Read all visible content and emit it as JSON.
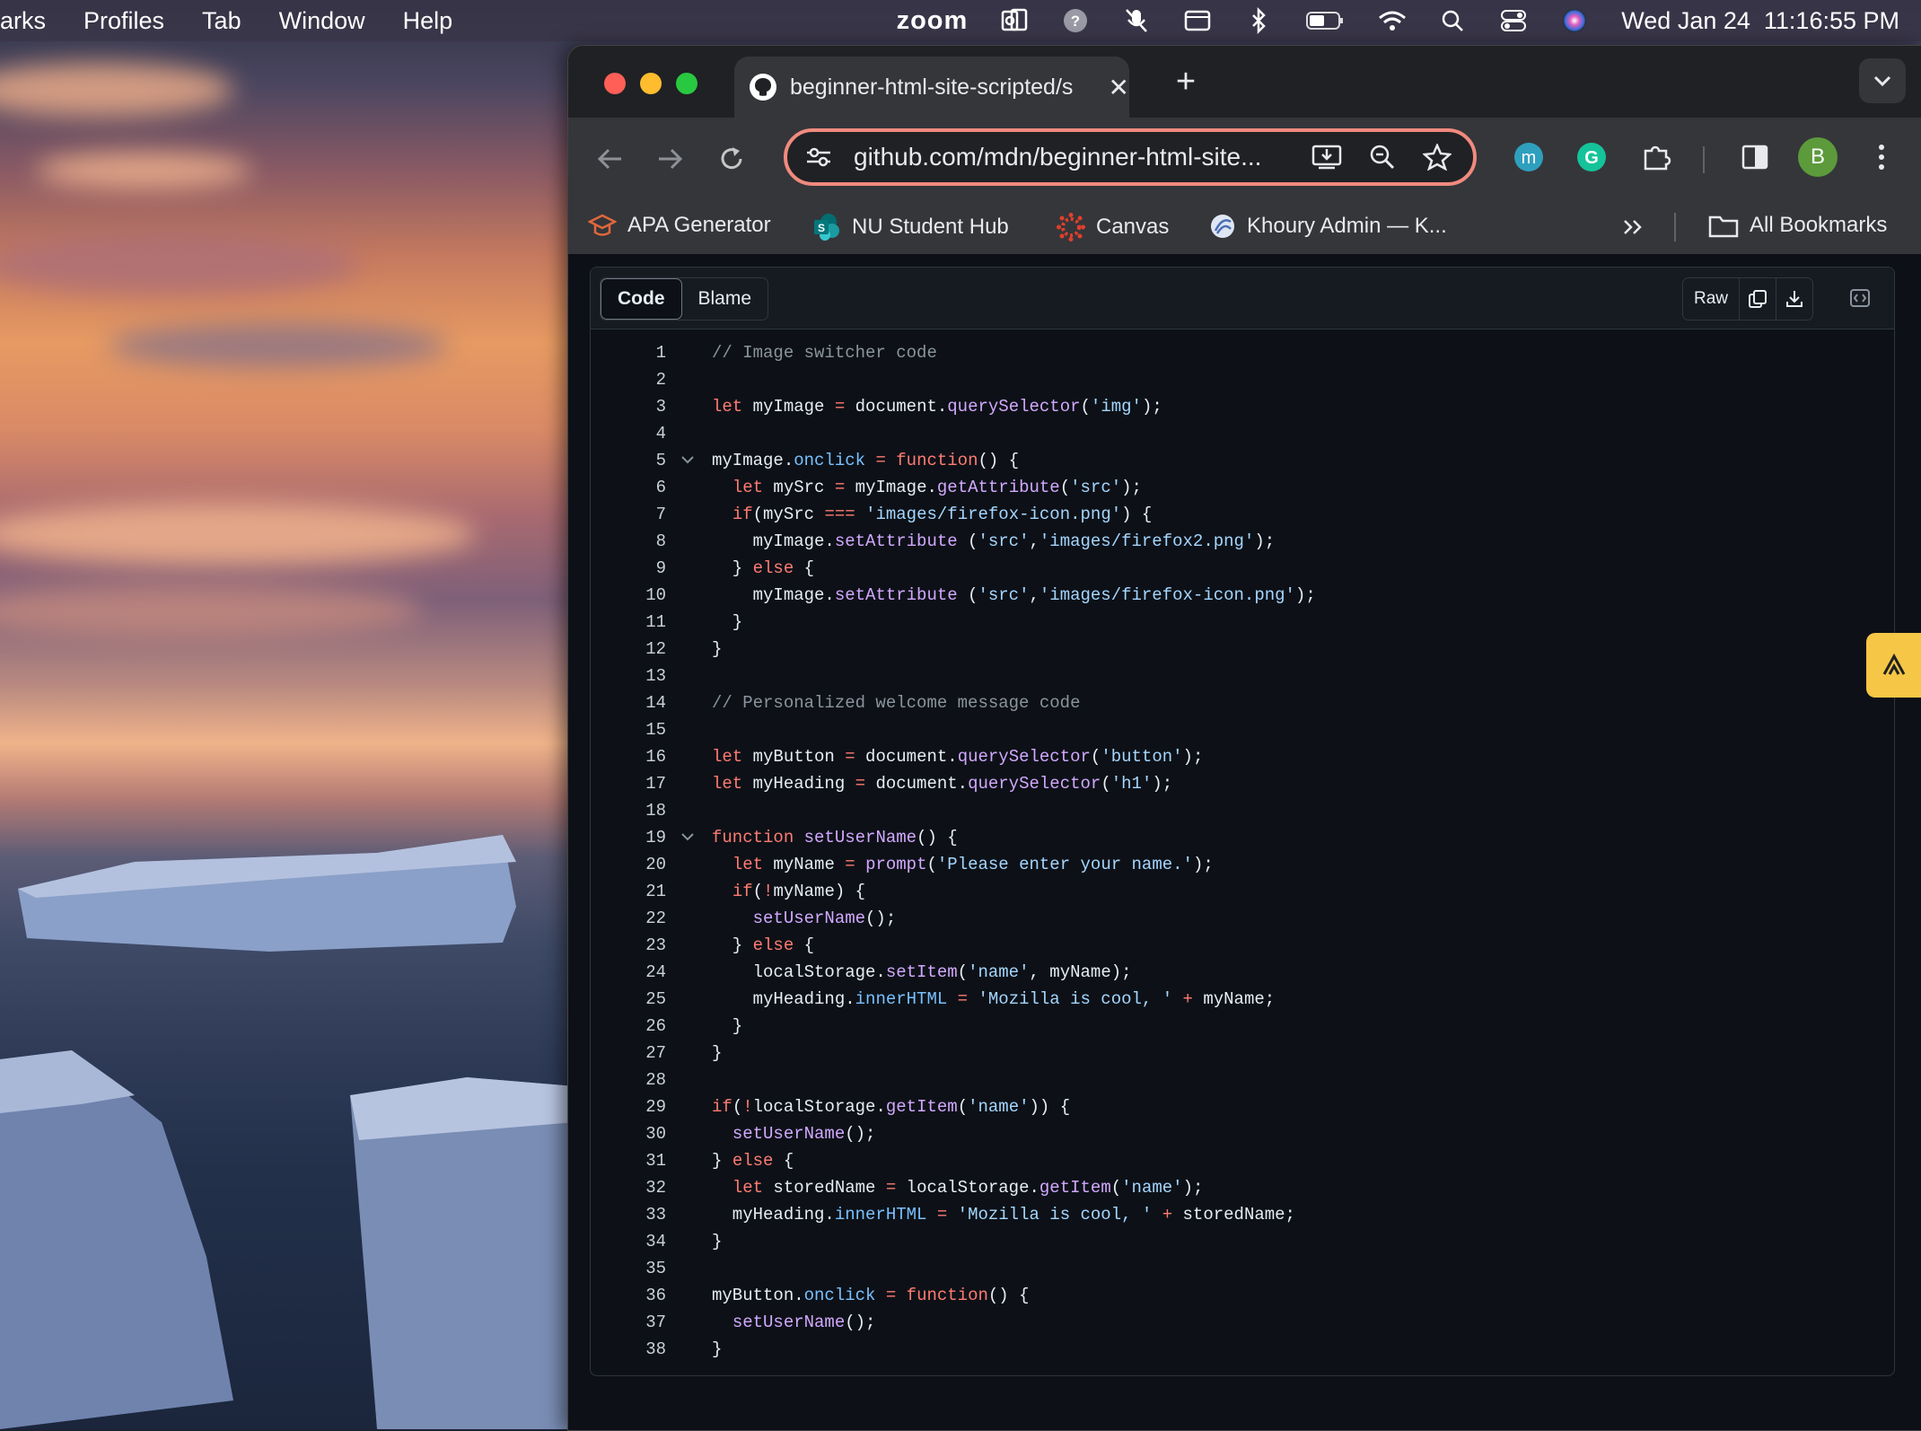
{
  "menubar": {
    "app_menu_partial": "arks",
    "items": [
      "Profiles",
      "Tab",
      "Window",
      "Help"
    ],
    "zoom_label": "zoom",
    "datetime": "Wed Jan 24  11:16:55 PM"
  },
  "browser": {
    "tab_title": "beginner-html-site-scripted/s",
    "url": "github.com/mdn/beginner-html-site...",
    "profile_initial": "B",
    "bookmarks": [
      {
        "label": "APA Generator",
        "icon": "apa-icon"
      },
      {
        "label": "NU Student Hub",
        "icon": "sharepoint-icon"
      },
      {
        "label": "Canvas",
        "icon": "canvas-icon"
      },
      {
        "label": "Khoury Admin — K...",
        "icon": "khoury-icon"
      }
    ],
    "all_bookmarks": "All Bookmarks"
  },
  "viewer": {
    "tab_code": "Code",
    "tab_blame": "Blame",
    "raw_label": "Raw"
  },
  "code_lines": [
    "// Image switcher code",
    "",
    "let myImage = document.querySelector('img');",
    "",
    "myImage.onclick = function() {",
    "  let mySrc = myImage.getAttribute('src');",
    "  if(mySrc === 'images/firefox-icon.png') {",
    "    myImage.setAttribute ('src','images/firefox2.png');",
    "  } else {",
    "    myImage.setAttribute ('src','images/firefox-icon.png');",
    "  }",
    "}",
    "",
    "// Personalized welcome message code",
    "",
    "let myButton = document.querySelector('button');",
    "let myHeading = document.querySelector('h1');",
    "",
    "function setUserName() {",
    "  let myName = prompt('Please enter your name.');",
    "  if(!myName) {",
    "    setUserName();",
    "  } else {",
    "    localStorage.setItem('name', myName);",
    "    myHeading.innerHTML = 'Mozilla is cool, ' + myName;",
    "  }",
    "}",
    "",
    "if(!localStorage.getItem('name')) {",
    "  setUserName();",
    "} else {",
    "  let storedName = localStorage.getItem('name');",
    "  myHeading.innerHTML = 'Mozilla is cool, ' + storedName;",
    "}",
    "",
    "myButton.onclick = function() {",
    "  setUserName();",
    "}"
  ],
  "folded_lines": [
    5,
    19
  ],
  "colors": {
    "close": "#ff5f57",
    "minimize": "#febc2e",
    "maximize": "#28c840",
    "omnibox_border": "#f08a7e",
    "code_bg": "#0d1117",
    "keyword": "#ff7b72",
    "function": "#d2a8ff",
    "string": "#a5d6ff",
    "comment": "#8b949e"
  }
}
